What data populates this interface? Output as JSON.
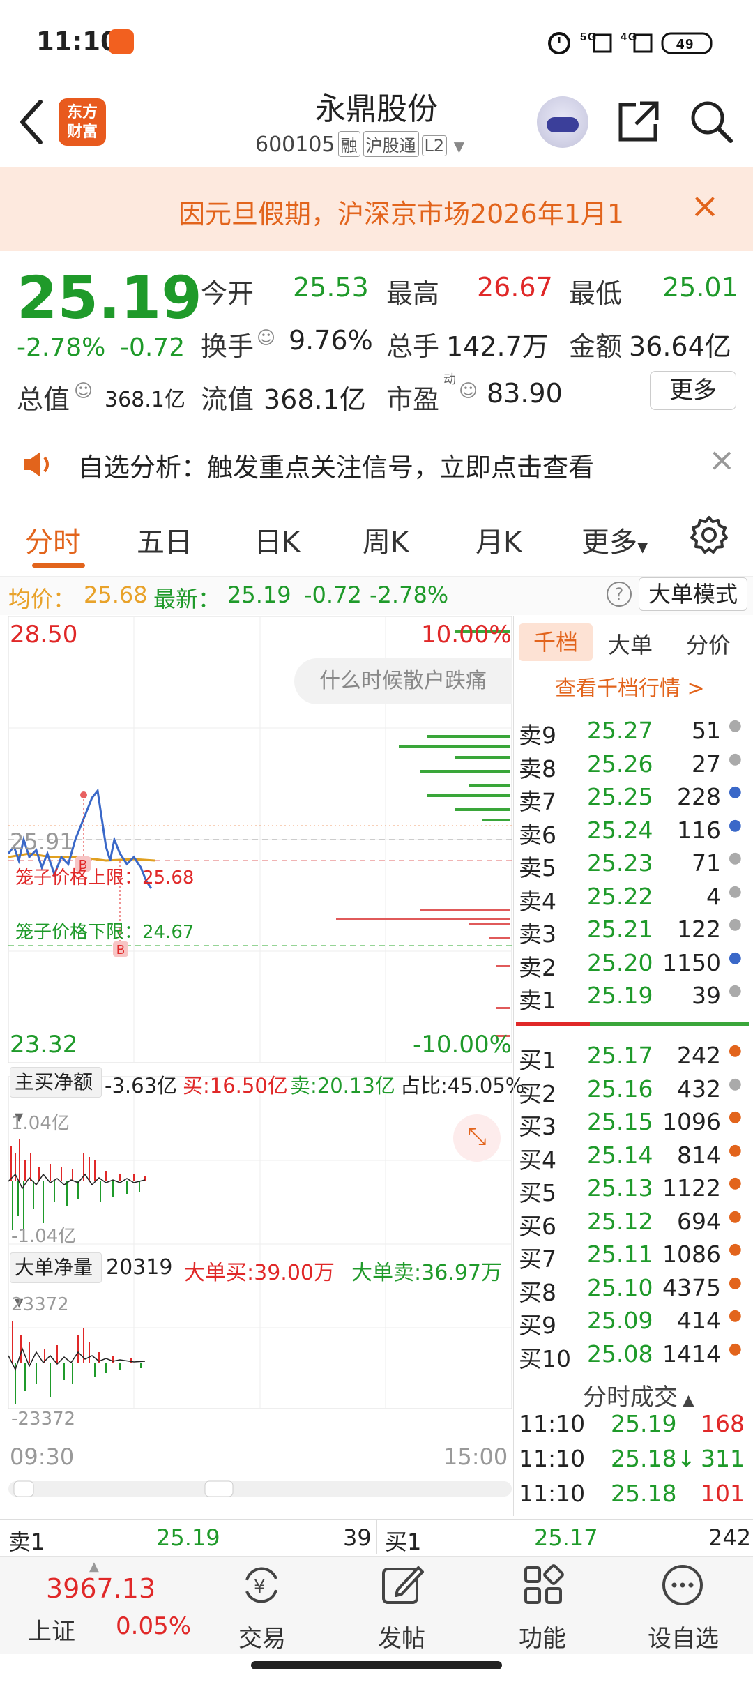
{
  "status": {
    "time": "11:10",
    "icons": "ⓐ 5G 4G 49",
    "battery": "49"
  },
  "header": {
    "title": "永鼎股份",
    "code": "600105",
    "tag1": "融",
    "tag2": "沪股通",
    "tag3": "L2",
    "logo_line1": "东方",
    "logo_line2": "财富"
  },
  "notice": {
    "text": "因元旦假期，沪深京市场2026年1月1",
    "close": "×"
  },
  "quote": {
    "price": "25.19",
    "pct": "-2.78%",
    "chg": "-0.72",
    "open_label": "今开",
    "open": "25.53",
    "high_label": "最高",
    "high": "26.67",
    "low_label": "最低",
    "low": "25.01",
    "turnover_label": "换手",
    "turnover": "9.76%",
    "volume_label": "总手",
    "volume": "142.7万",
    "amount_label": "金额",
    "amount": "36.64亿",
    "mcap_label": "总值",
    "mcap": "368.1亿",
    "float_label": "流值",
    "float": "368.1亿",
    "pe_label": "市盈",
    "pe_sup": "动",
    "pe": "83.90",
    "more": "更多"
  },
  "signal": {
    "text": "自选分析：触发重点关注信号，立即点击查看",
    "close": "×"
  },
  "tabs": [
    "分时",
    "五日",
    "日K",
    "周K",
    "月K",
    "更多"
  ],
  "avgbar": {
    "avg_label": "均价：",
    "avg": "25.68",
    "last_label": "最新：",
    "last": "25.19",
    "chg": "-0.72",
    "pct": "-2.78%",
    "mode": "大单模式"
  },
  "chart": {
    "top_price": "28.50",
    "top_pct": "10.00%",
    "bot_price": "23.32",
    "bot_pct": "-10.00%",
    "prev_close": "25.91",
    "cage_upper": "笼子价格上限：25.68",
    "cage_lower": "笼子价格下限：24.67",
    "tooltip": "什么时候散户跌痛",
    "ind1_name": "主买净额",
    "ind1_val": "-3.63亿",
    "ind1_buy": "买:16.50亿",
    "ind1_sell": "卖:20.13亿",
    "ind1_ratio": "占比:45.05%",
    "ind1_max": "1.04亿",
    "ind1_min": "-1.04亿",
    "ind2_name": "大单净量",
    "ind2_val": "20319",
    "ind2_buy": "大单买:39.00万",
    "ind2_sell": "大单卖:36.97万",
    "ind2_max": "23372",
    "ind2_min": "-23372",
    "t_start": "09:30",
    "t_end": "15:00"
  },
  "book": {
    "tabs": [
      "千档",
      "大单",
      "分价"
    ],
    "link": "查看千档行情 >",
    "asks": [
      [
        "卖9",
        "25.27",
        "51"
      ],
      [
        "卖8",
        "25.26",
        "27"
      ],
      [
        "卖7",
        "25.25",
        "228"
      ],
      [
        "卖6",
        "25.24",
        "116"
      ],
      [
        "卖5",
        "25.23",
        "71"
      ],
      [
        "卖4",
        "25.22",
        "4"
      ],
      [
        "卖3",
        "25.21",
        "122"
      ],
      [
        "卖2",
        "25.20",
        "1150"
      ],
      [
        "卖1",
        "25.19",
        "39"
      ]
    ],
    "bids": [
      [
        "买1",
        "25.17",
        "242"
      ],
      [
        "买2",
        "25.16",
        "432"
      ],
      [
        "买3",
        "25.15",
        "1096"
      ],
      [
        "买4",
        "25.14",
        "814"
      ],
      [
        "买5",
        "25.13",
        "1122"
      ],
      [
        "买6",
        "25.12",
        "694"
      ],
      [
        "买7",
        "25.11",
        "1086"
      ],
      [
        "买8",
        "25.10",
        "4375"
      ],
      [
        "买9",
        "25.09",
        "414"
      ],
      [
        "买10",
        "25.08",
        "1414"
      ]
    ],
    "trades_title": "分时成交",
    "trades": [
      [
        "11:10",
        "25.19",
        "168"
      ],
      [
        "11:10",
        "25.18↓",
        "311"
      ],
      [
        "11:10",
        "25.18",
        "101"
      ]
    ]
  },
  "bottomq": {
    "ask_label": "卖1",
    "ask_price": "25.19",
    "ask_vol": "39",
    "bid_label": "买1",
    "bid_price": "25.17",
    "bid_vol": "242"
  },
  "nav": {
    "index_value": "3967.13",
    "index_name": "上证",
    "index_pct": "0.05%",
    "items": [
      "交易",
      "发帖",
      "功能",
      "设自选"
    ]
  }
}
